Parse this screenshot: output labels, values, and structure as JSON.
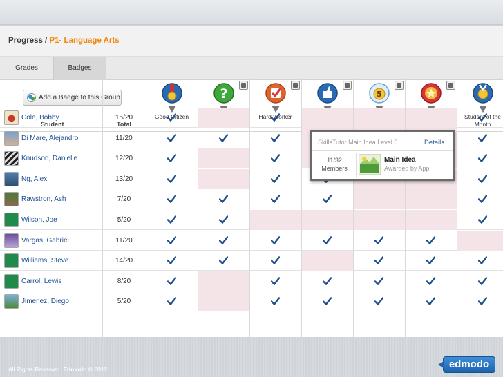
{
  "breadcrumb": {
    "section": "Progress",
    "separator": " / ",
    "group": "P1- Language Arts"
  },
  "tabs": [
    {
      "label": "Grades"
    },
    {
      "label": "Badges"
    }
  ],
  "add_badge_button": {
    "label": "Add a Badge to this Group"
  },
  "columns": {
    "student": "Student",
    "total": "Total"
  },
  "badges": [
    {
      "name": "Good Citizen",
      "icon": "medal-icon",
      "color": "#2a6ab3"
    },
    {
      "name": "Good Question",
      "icon": "question-mark-icon",
      "color": "#3ea83a"
    },
    {
      "name": "Hard Worker",
      "icon": "checkmark-badge-icon",
      "color": "#e0632b"
    },
    {
      "name": "Homework Helper",
      "icon": "thumbs-up-icon",
      "color": "#2a6ab3"
    },
    {
      "name": "SkillsTutor Main Idea Level 5",
      "icon": "skillstutor-level-5-icon",
      "color": "#7fb3e0"
    },
    {
      "name": "Star Performer",
      "icon": "star-icon",
      "color": "#d8333a"
    },
    {
      "name": "Student of the Month",
      "icon": "award-ribbon-icon",
      "color": "#2a6ab3"
    }
  ],
  "students": [
    {
      "name": "Cole, Bobby",
      "total": "15/20",
      "badges": [
        1,
        0,
        1,
        0,
        0,
        0,
        1
      ]
    },
    {
      "name": "Di Mare, Alejandro",
      "total": "11/20",
      "badges": [
        1,
        1,
        1,
        0,
        0,
        0,
        1
      ]
    },
    {
      "name": "Knudson, Danielle",
      "total": "12/20",
      "badges": [
        1,
        0,
        1,
        0,
        0,
        0,
        1
      ]
    },
    {
      "name": "Ng, Alex",
      "total": "13/20",
      "badges": [
        1,
        0,
        1,
        1,
        0,
        0,
        1
      ]
    },
    {
      "name": "Rawstron, Ash",
      "total": "7/20",
      "badges": [
        1,
        1,
        1,
        1,
        0,
        0,
        1
      ]
    },
    {
      "name": "Wilson, Joe",
      "total": "5/20",
      "badges": [
        1,
        1,
        0,
        0,
        0,
        0,
        1
      ]
    },
    {
      "name": "Vargas, Gabriel",
      "total": "11/20",
      "badges": [
        1,
        1,
        1,
        1,
        1,
        1,
        0
      ]
    },
    {
      "name": "Williams, Steve",
      "total": "14/20",
      "badges": [
        1,
        1,
        1,
        0,
        1,
        1,
        1
      ]
    },
    {
      "name": "Carrol, Lewis",
      "total": "8/20",
      "badges": [
        1,
        0,
        1,
        1,
        1,
        1,
        1
      ]
    },
    {
      "name": "Jimenez, Diego",
      "total": "5/20",
      "badges": [
        1,
        0,
        1,
        1,
        1,
        1,
        1
      ]
    }
  ],
  "popover": {
    "title": "SkillsTutor Main Idea Level 5",
    "details_label": "Details",
    "count": "11/32",
    "members_label": "Members",
    "badge_name": "Main Idea",
    "awarded_by": "Awarded by App"
  },
  "footer": {
    "rights": "All Rights Reserved.",
    "brand": "Edmodo",
    "year": "© 2012",
    "logo": "edmodo"
  }
}
